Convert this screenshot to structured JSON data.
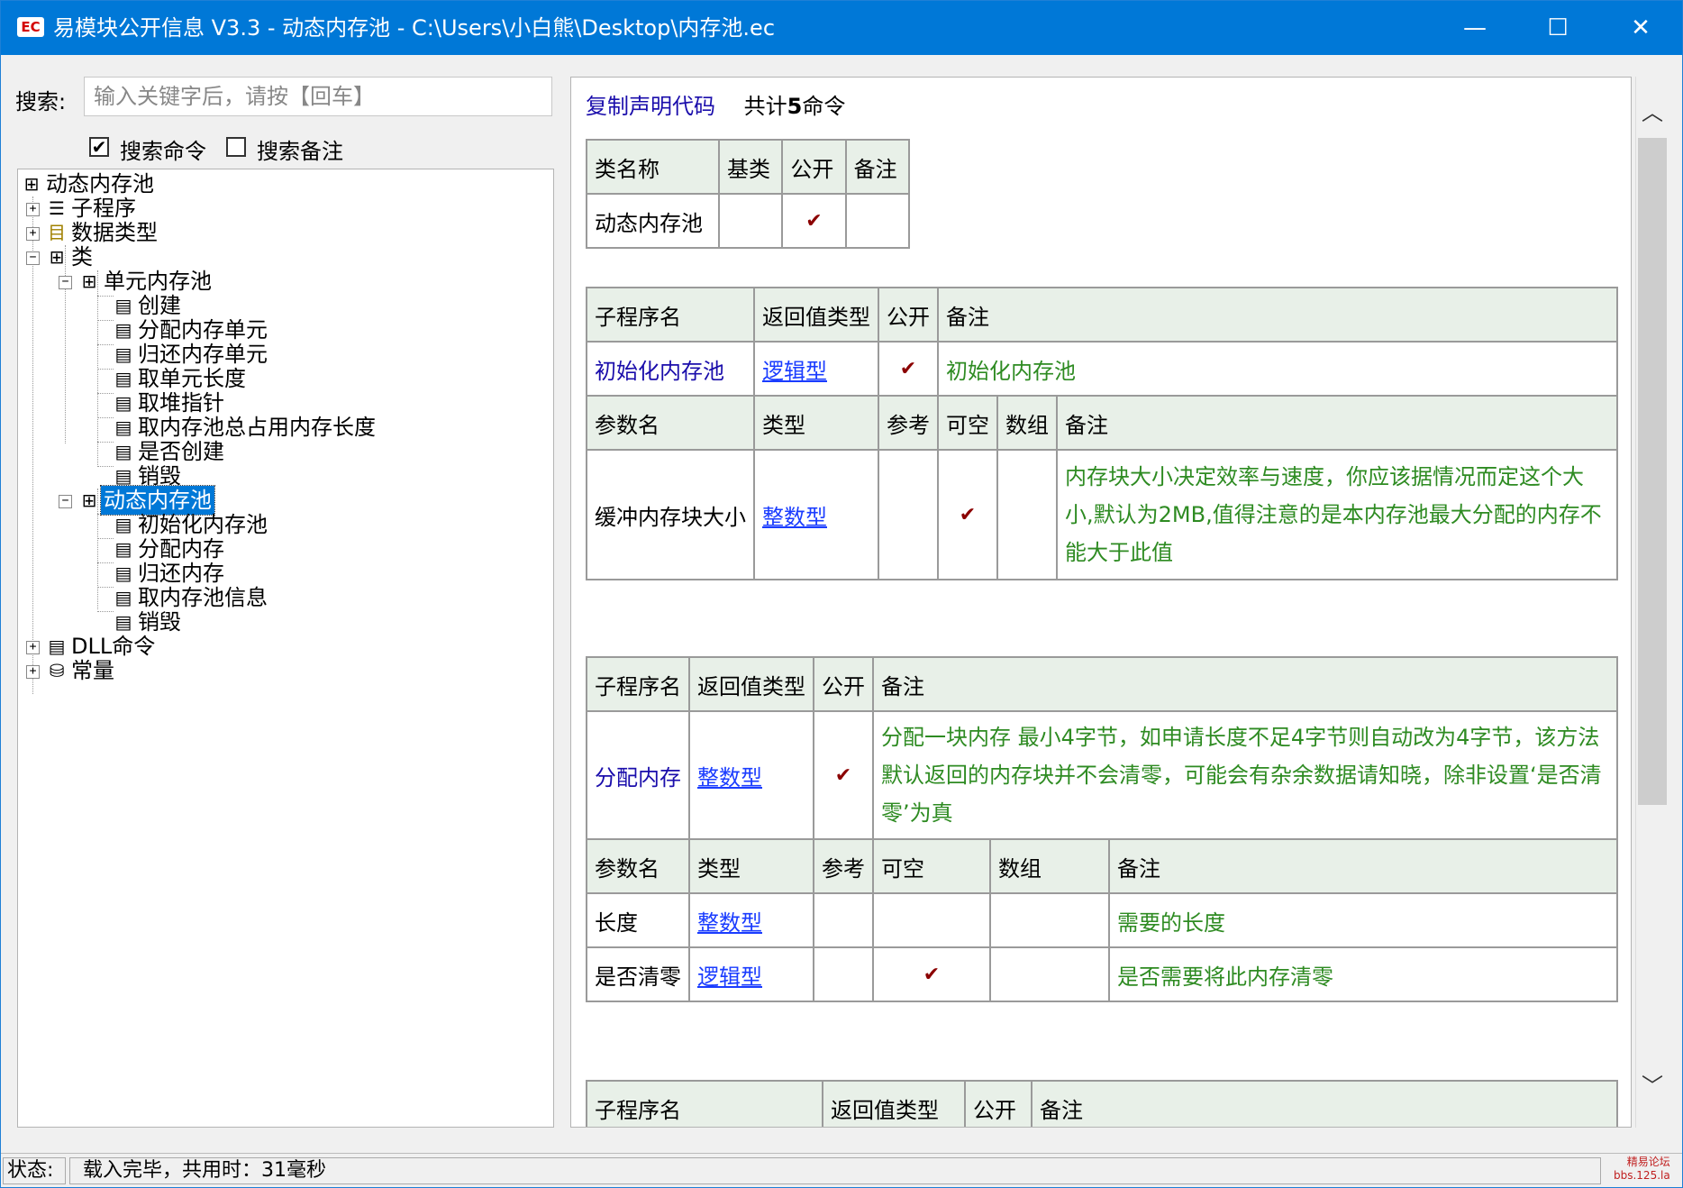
{
  "window": {
    "app_icon_text": "EC",
    "title": "易模块公开信息 V3.3 - 动态内存池 - C:\\Users\\小白熊\\Desktop\\内存池.ec",
    "minimize": "—",
    "maximize": "☐",
    "close": "✕"
  },
  "search": {
    "label": "搜索:",
    "placeholder": "输入关键字后，请按【回车】",
    "opt_cmd": "搜索命令",
    "opt_cmd_checked": true,
    "opt_note": "搜索备注",
    "opt_note_checked": false
  },
  "tree": {
    "root": "动态内存池",
    "subprograms": "子程序",
    "datatypes": "数据类型",
    "classes": "类",
    "class1": "单元内存池",
    "class1_methods": [
      "创建",
      "分配内存单元",
      "归还内存单元",
      "取单元长度",
      "取堆指针",
      "取内存池总占用内存长度",
      "是否创建",
      "销毁"
    ],
    "class2": "动态内存池",
    "class2_methods": [
      "初始化内存池",
      "分配内存",
      "归还内存",
      "取内存池信息",
      "销毁"
    ],
    "dll": "DLL命令",
    "consts": "常量"
  },
  "content": {
    "copy_link": "复制声明代码",
    "count_prefix": "共计",
    "count": "5",
    "count_suffix": "命令",
    "class_table": {
      "headers": [
        "类名称",
        "基类",
        "公开",
        "备注"
      ],
      "row": {
        "name": "动态内存池",
        "base": "",
        "public": "✔",
        "note": ""
      }
    },
    "sub1": {
      "headers": [
        "子程序名",
        "返回值类型",
        "公开",
        "备注"
      ],
      "name": "初始化内存池",
      "ret": "逻辑型",
      "public": "✔",
      "note": "初始化内存池",
      "param_headers": [
        "参数名",
        "类型",
        "参考",
        "可空",
        "数组",
        "备注"
      ],
      "params": [
        {
          "name": "缓冲内存块大小",
          "type": "整数型",
          "ref": "",
          "nullable": "✔",
          "array": "",
          "note": "内存块大小决定效率与速度，你应该据情况而定这个大小,默认为2MB,值得注意的是本内存池最大分配的内存不能大于此值"
        }
      ]
    },
    "sub2": {
      "headers": [
        "子程序名",
        "返回值类型",
        "公开",
        "备注"
      ],
      "name": "分配内存",
      "ret": "整数型",
      "public": "✔",
      "note": "分配一块内存 最小4字节，如申请长度不足4字节则自动改为4字节，该方法默认返回的内存块并不会清零，可能会有杂余数据请知晓，除非设置‘是否清零’为真",
      "param_headers": [
        "参数名",
        "类型",
        "参考",
        "可空",
        "数组",
        "备注"
      ],
      "params": [
        {
          "name": "长度",
          "type": "整数型",
          "ref": "",
          "nullable": "",
          "array": "",
          "note": "需要的长度"
        },
        {
          "name": "是否清零",
          "type": "逻辑型",
          "ref": "",
          "nullable": "✔",
          "array": "",
          "note": "是否需要将此内存清零"
        }
      ]
    },
    "sub3": {
      "headers": [
        "子程序名",
        "返回值类型",
        "公开",
        "备注"
      ]
    }
  },
  "scrollbar": {
    "up": "︿",
    "down": "﹀"
  },
  "status": {
    "label": "状态:",
    "text": "载入完毕，共用时：31毫秒",
    "watermark_line1": "精易论坛",
    "watermark_line2": "bbs.125.la"
  }
}
